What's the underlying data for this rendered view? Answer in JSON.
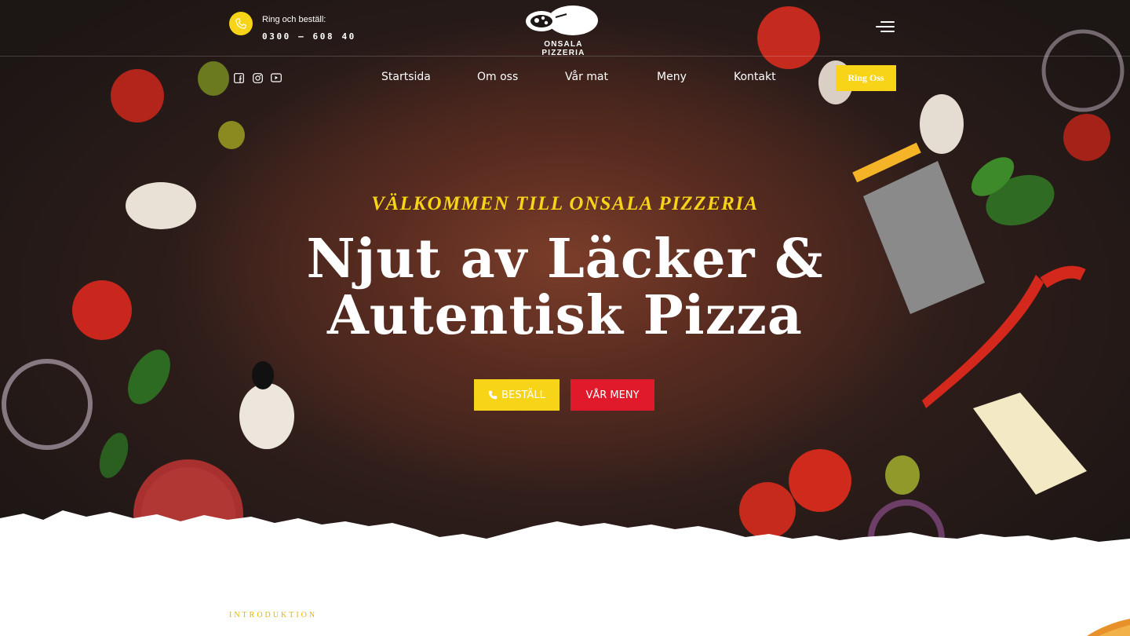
{
  "header": {
    "call_label": "Ring och beställ:",
    "call_number": "0300 – 608 40",
    "logo_text": "ONSALA PIZZERIA",
    "icons": [
      "phone-icon",
      "logo-icon",
      "hamburger-menu-icon"
    ]
  },
  "social": {
    "icons": [
      "facebook-icon",
      "instagram-icon",
      "youtube-icon"
    ]
  },
  "nav": {
    "items": [
      "Startsida",
      "Om oss",
      "Vår mat",
      "Meny",
      "Kontakt"
    ],
    "cta_label": "Ring Oss"
  },
  "hero": {
    "welcome": "VÄLKOMMEN TILL ONSALA PIZZERIA",
    "headline_line1": "Njut av Läcker &",
    "headline_line2": "Autentisk Pizza",
    "order_button": "BESTÄLL",
    "menu_button": "VÅR MENY"
  },
  "intro": {
    "label": "INTRODUKTION"
  },
  "colors": {
    "accent_yellow": "#f7d417",
    "accent_red": "#e01a2b",
    "background_dark": "#2b1c19"
  }
}
